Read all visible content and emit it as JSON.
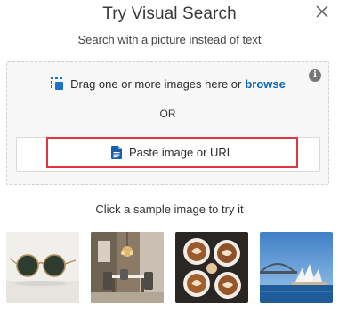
{
  "dialog": {
    "title": "Try Visual Search",
    "subtitle": "Search with a picture instead of text",
    "close_icon": "close-icon"
  },
  "dropzone": {
    "info_icon": "info-icon",
    "info_glyph": "i",
    "drag_icon": "drag-drop-icon",
    "drag_text": "Drag one or more images here or",
    "browse_label": "browse",
    "or_label": "OR",
    "paste_icon": "document-icon",
    "paste_label": "Paste image or URL"
  },
  "samples": {
    "caption": "Click a sample image to try it",
    "items": [
      {
        "name": "sunglasses"
      },
      {
        "name": "dining-room"
      },
      {
        "name": "coffee-cups"
      },
      {
        "name": "sydney-opera-house"
      }
    ]
  },
  "colors": {
    "accent": "#0b66b5",
    "highlight": "#e03540",
    "dropzone_bg": "#f7f7f7"
  }
}
